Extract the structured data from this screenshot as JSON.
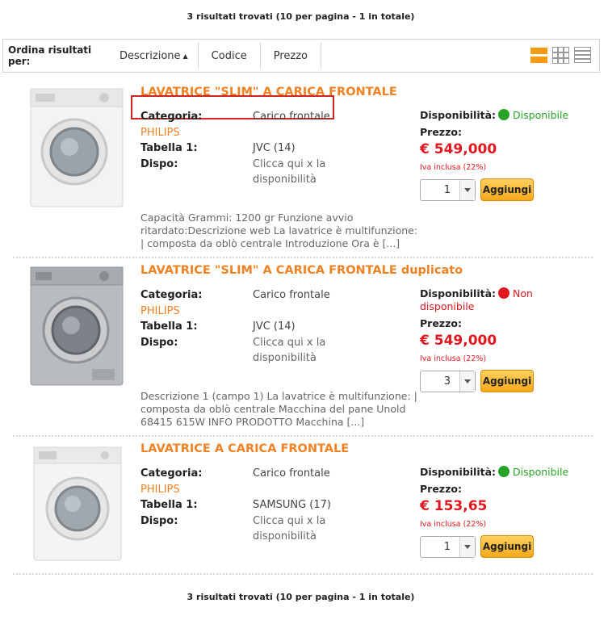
{
  "results": {
    "top_text": "3 risultati trovati (10 per pagina - 1 in totale)",
    "bottom_text": "3 risultati trovati (10 per pagina - 1 in totale)"
  },
  "sortbar": {
    "label": "Ordina risultati per:",
    "options": [
      "Descrizione",
      "Codice",
      "Prezzo"
    ],
    "active_sort_arrow": "▲",
    "views": [
      "list-view-icon",
      "grid-view-icon",
      "compact-list-icon"
    ]
  },
  "colors": {
    "accent": "#f08223",
    "price": "#e2161e",
    "available": "#27a327",
    "unavailable": "#e2161e"
  },
  "labels": {
    "categoria": "Categoria:",
    "tabella": "Tabella 1:",
    "dispo": "Dispo:",
    "disponibilita": "Disponibilità:",
    "prezzo": "Prezzo:",
    "iva": "Iva inclusa (22%)",
    "add_button": "Aggiungi"
  },
  "products": [
    {
      "title": "LAVATRICE \"SLIM\" A CARICA FRONTALE",
      "categoria": "Carico frontale",
      "brand": "PHILIPS",
      "tabella": "JVC (14)",
      "dispo": "Clicca qui x la disponibilità",
      "availability": "Disponibile",
      "available": true,
      "price": "€ 549,000",
      "qty": "1",
      "desc": "Capacità Grammi: 1200 gr Funzione avvio ritardato:Descrizione web La lavatrice è multifunzione: | composta da oblò centrale Introduzione Ora è [...]"
    },
    {
      "title": "LAVATRICE \"SLIM\" A CARICA FRONTALE duplicato",
      "categoria": "Carico frontale",
      "brand": "PHILIPS",
      "tabella": "JVC (14)",
      "dispo": "Clicca qui x la disponibilità",
      "availability": "Non disponibile",
      "available": false,
      "price": "€ 549,000",
      "qty": "3",
      "desc": "Descrizione 1 (campo 1) La lavatrice è multifunzione: | composta da oblò centrale Macchina del pane Unold 68415 615W INFO PRODOTTO Macchina [...]"
    },
    {
      "title": "LAVATRICE A CARICA FRONTALE",
      "categoria": "Carico frontale",
      "brand": "PHILIPS",
      "tabella": "SAMSUNG (17)",
      "dispo": "Clicca qui x la disponibilità",
      "availability": "Disponibile",
      "available": true,
      "price": "€ 153,65",
      "qty": "1",
      "desc": ""
    }
  ]
}
